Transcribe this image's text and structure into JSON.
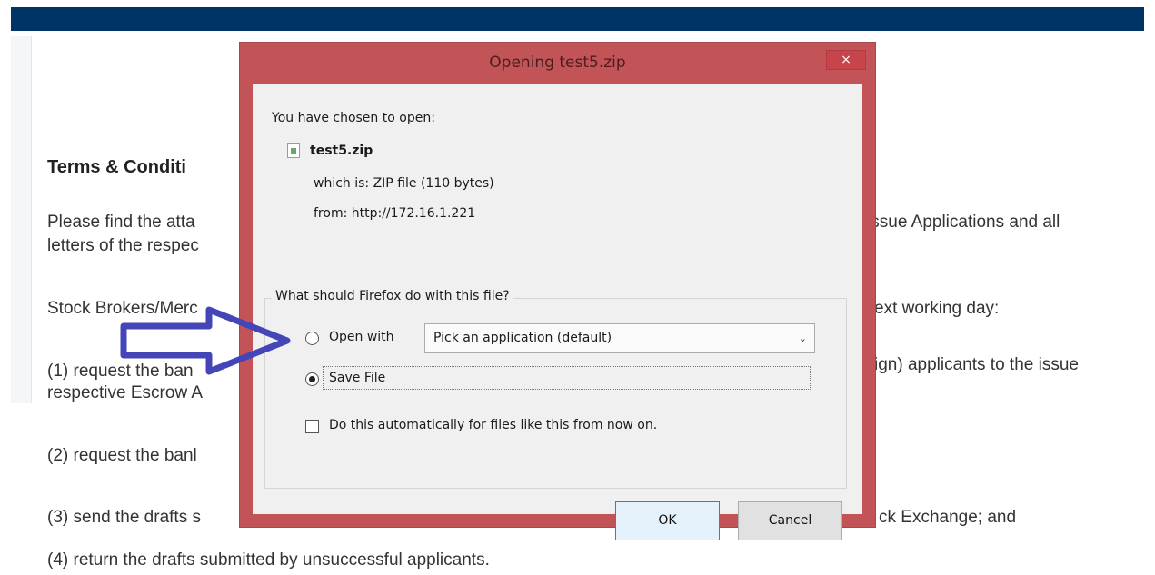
{
  "page": {
    "heading": "Terms & Conditi",
    "lines": [
      "Please find the atta",
      "Issue Applications and all",
      "letters of the respec",
      "Stock Brokers/Merc",
      "ext working day:",
      "(1) request the ban",
      "ign) applicants to the issue",
      "respective Escrow A",
      "(2) request the banl",
      "(3) send the drafts s",
      "ck Exchange; and",
      "(4) return the drafts submitted by unsuccessful applicants."
    ]
  },
  "dialog": {
    "title": "Opening test5.zip",
    "close_glyph": "×",
    "chosen_label": "You have chosen to open:",
    "file_name": "test5.zip",
    "which_is": "which is:  ZIP file (110 bytes)",
    "from": "from:  http://172.16.1.221",
    "question": "What should Firefox do with this file?",
    "open_with_label": "Open with",
    "open_with_value": "Pick an application (default)",
    "open_with_checked": false,
    "save_file_label": "Save File",
    "save_file_checked": true,
    "auto_label": "Do this automatically for files like this from now on.",
    "auto_checked": false,
    "ok_label": "OK",
    "cancel_label": "Cancel"
  },
  "colors": {
    "topbar": "#003366",
    "dialog_frame": "#c25458",
    "arrow_stroke": "#4446b8"
  },
  "icons": {
    "file": "zip-file-icon",
    "dropdown": "chevron-down-icon",
    "close": "close-icon",
    "annotation": "arrow-right-icon"
  }
}
